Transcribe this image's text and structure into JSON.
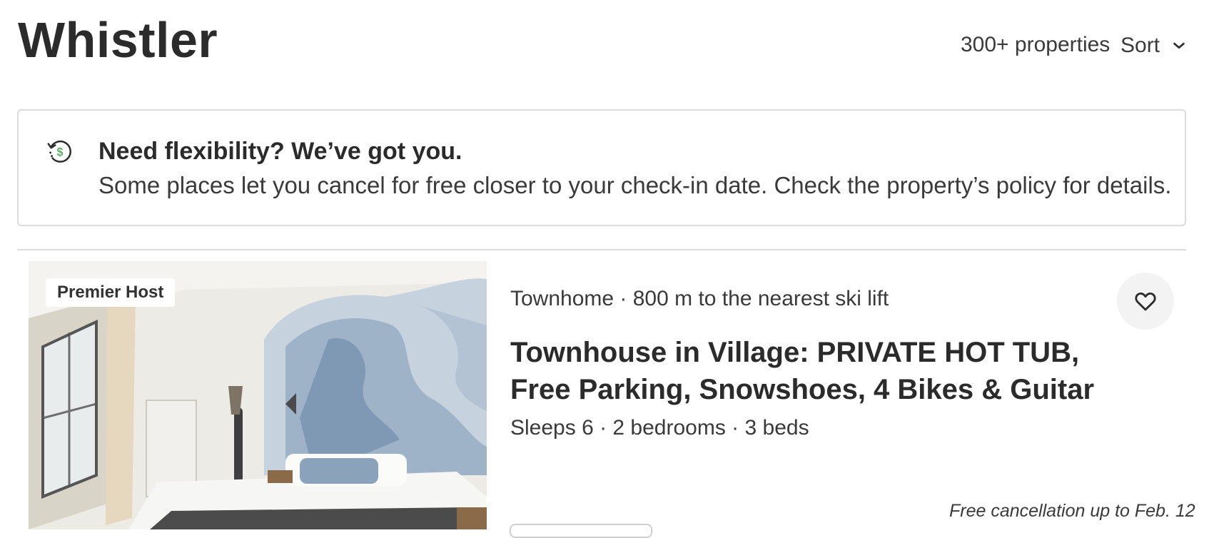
{
  "header": {
    "title": "Whistler",
    "property_count": "300+ properties",
    "sort_label": "Sort"
  },
  "banner": {
    "icon": "refund-clock-icon",
    "title": "Need flexibility? We’ve got you.",
    "text": "Some places let you cancel for free closer to your check-in date. Check the property’s policy for details."
  },
  "listing": {
    "badge": "Premier Host",
    "meta": "Townhome · 800 m to the nearest ski lift",
    "title": "Townhouse in Village: PRIVATE HOT TUB, Free Parking, Snowshoes, 4 Bikes & Guitar",
    "specs": "Sleeps 6 · 2 bedrooms · 3 beds",
    "cancellation": "Free cancellation up to Feb. 12",
    "favorite_icon": "heart-outline-icon"
  },
  "colors": {
    "text": "#2b2b2b",
    "border": "#dcdcdc",
    "refund_accent": "#5cae6a",
    "favorite_bg": "#f3f3f3"
  }
}
